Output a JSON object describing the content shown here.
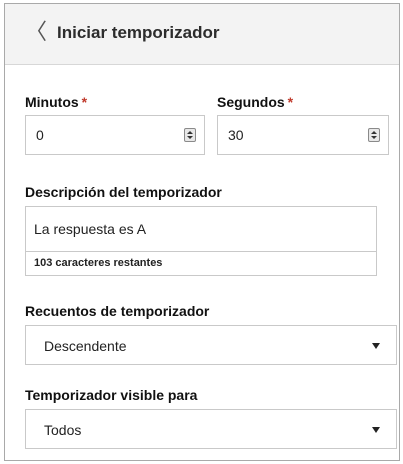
{
  "header": {
    "back_icon": "chevron-left-icon",
    "title": "Iniciar temporizador"
  },
  "minutes": {
    "label": "Minutos",
    "required_mark": "*",
    "value": "0"
  },
  "seconds": {
    "label": "Segundos",
    "required_mark": "*",
    "value": "30"
  },
  "description": {
    "label": "Descripción del temporizador",
    "value": "La respuesta es A",
    "counter": "103 caracteres restantes"
  },
  "counting": {
    "label": "Recuentos de temporizador",
    "selected": "Descendente"
  },
  "visibility": {
    "label": "Temporizador visible para",
    "selected": "Todos"
  },
  "colors": {
    "required": "#c0392b",
    "header_bg": "#f3f3f3"
  }
}
